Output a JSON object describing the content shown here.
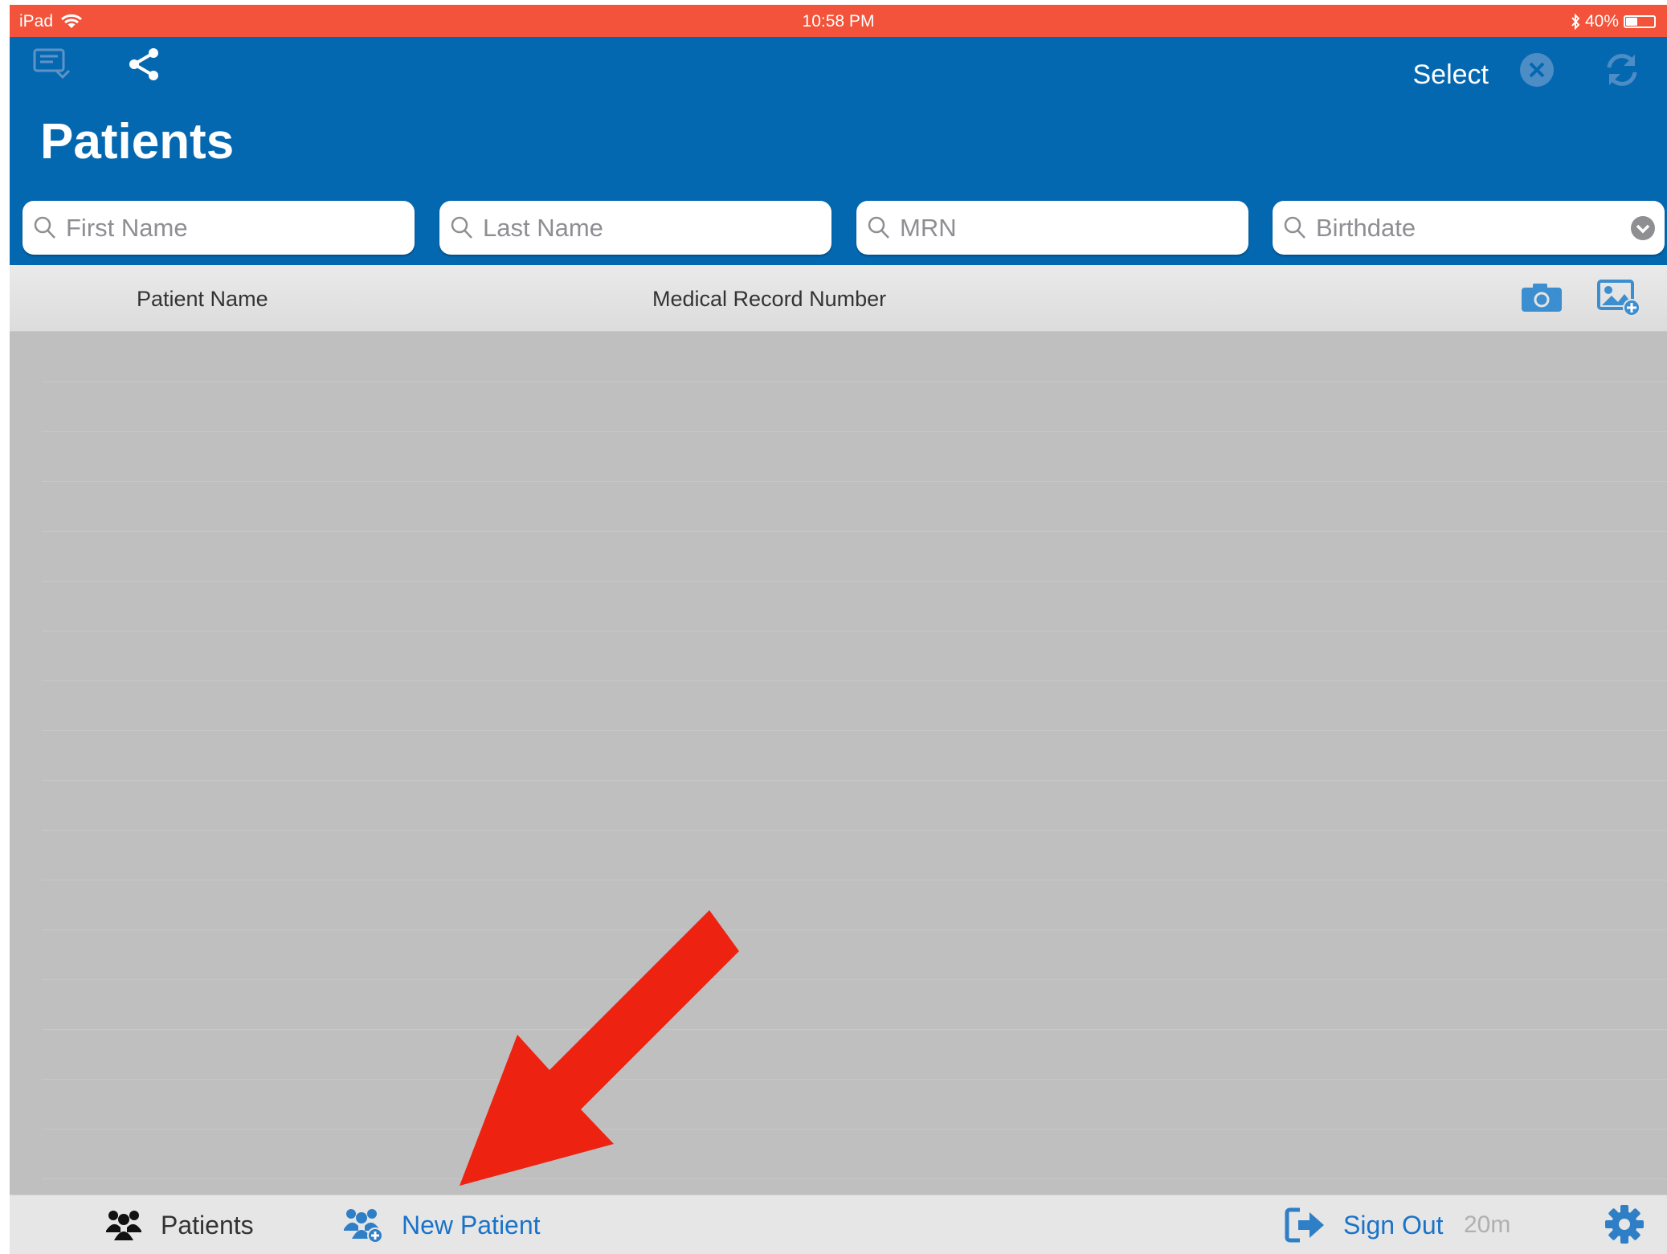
{
  "status_bar": {
    "carrier": "iPad",
    "time": "10:58 PM",
    "battery": "40%",
    "battery_level": 0.4,
    "icons": [
      "wifi-icon",
      "bluetooth-icon",
      "battery-icon"
    ]
  },
  "nav": {
    "left_icons": [
      "device-sync-icon",
      "share-icon"
    ],
    "select_label": "Select",
    "right_icons": [
      "clear-circle-icon",
      "refresh-icon"
    ],
    "title": "Patients"
  },
  "search": {
    "first_name": {
      "placeholder": "First Name",
      "value": ""
    },
    "last_name": {
      "placeholder": "Last Name",
      "value": ""
    },
    "mrn": {
      "placeholder": "MRN",
      "value": ""
    },
    "birthdate": {
      "placeholder": "Birthdate",
      "value": ""
    },
    "icon": "search-icon"
  },
  "table": {
    "columns": [
      "Patient Name",
      "Medical Record Number"
    ],
    "header_icons": [
      "camera-icon",
      "add-photo-icon"
    ],
    "rows": []
  },
  "tab_bar": {
    "patients_label": "Patients",
    "new_patient_label": "New Patient",
    "sign_out_label": "Sign Out",
    "session_timeout": "20m",
    "icons": [
      "patients-icon",
      "new-patient-icon",
      "sign-out-icon",
      "settings-gear-icon"
    ]
  },
  "colors": {
    "status_bar": "#f2533a",
    "nav_bar": "#0468b1",
    "accent": "#1a73c8",
    "annotation_arrow": "#ee2211",
    "background": "#bfbfbf"
  }
}
